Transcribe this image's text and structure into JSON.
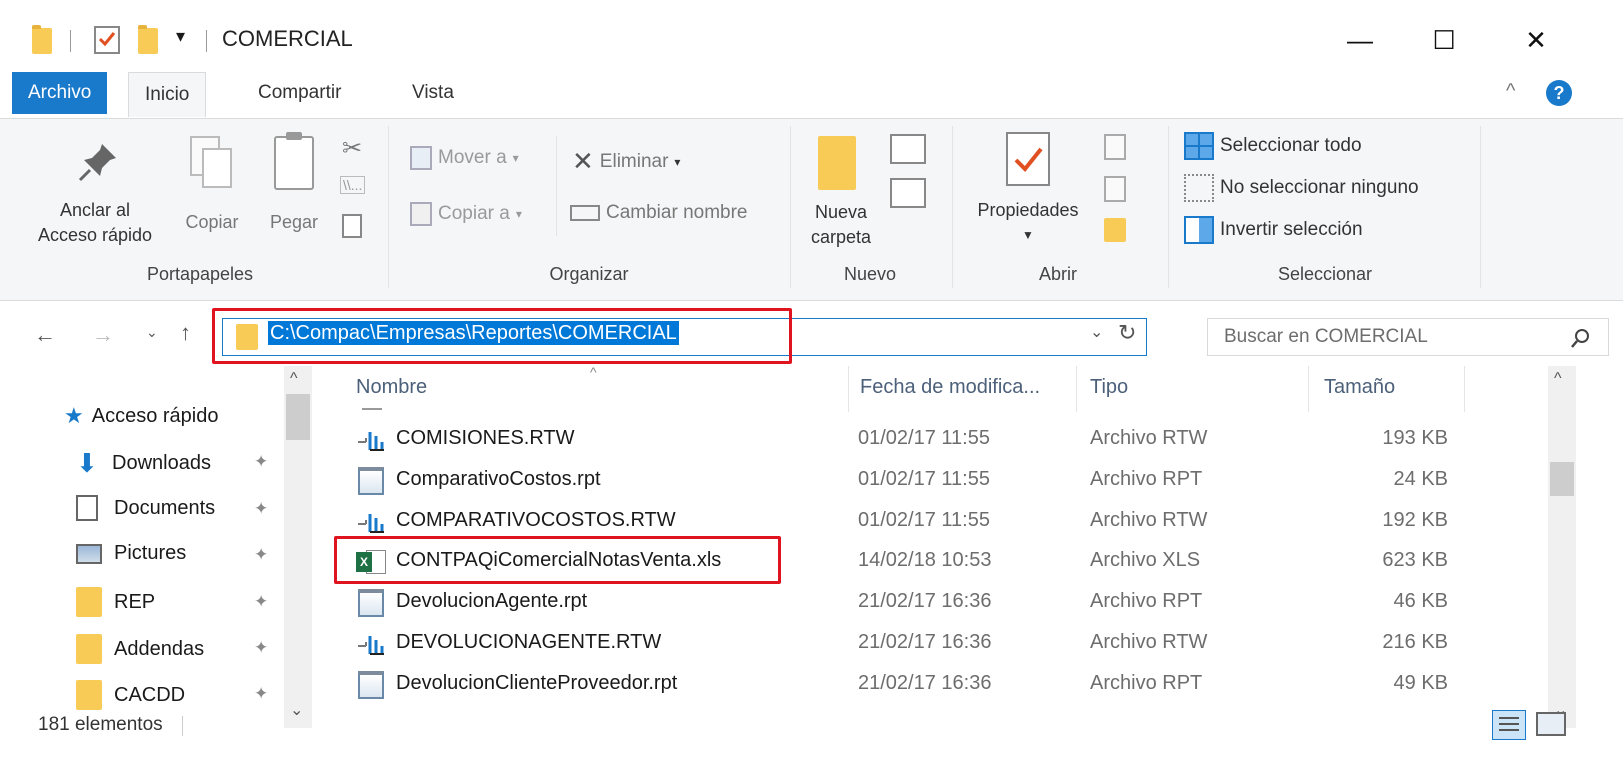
{
  "window": {
    "title": "COMERCIAL",
    "qat_dropdown": "▾",
    "minimize": "—",
    "maximize": "☐",
    "close": "✕"
  },
  "tabs": [
    {
      "label": "Archivo"
    },
    {
      "label": "Inicio"
    },
    {
      "label": "Compartir"
    },
    {
      "label": "Vista"
    }
  ],
  "ribbon": {
    "collapse_icon": "^",
    "help_icon": "?",
    "portapapeles": {
      "label": "Portapapeles",
      "pin_label_1": "Anclar al",
      "pin_label_2": "Acceso rápido",
      "copy_label": "Copiar",
      "paste_label": "Pegar"
    },
    "organizar": {
      "label": "Organizar",
      "move_to": "Mover a",
      "copy_to": "Copiar a",
      "delete": "Eliminar",
      "rename": "Cambiar nombre"
    },
    "nuevo": {
      "label": "Nuevo",
      "new_folder_1": "Nueva",
      "new_folder_2": "carpeta"
    },
    "abrir": {
      "label": "Abrir",
      "properties": "Propiedades"
    },
    "seleccionar": {
      "label": "Seleccionar",
      "select_all": "Seleccionar todo",
      "select_none": "No seleccionar ninguno",
      "invert": "Invertir selección"
    }
  },
  "address": {
    "path": "C:\\Compac\\Empresas\\Reportes\\COMERCIAL",
    "search_placeholder": "Buscar en COMERCIAL"
  },
  "nav_pane": {
    "quick_access": "Acceso rápido",
    "items": [
      {
        "label": "Downloads",
        "icon": "download-arrow-icon"
      },
      {
        "label": "Documents",
        "icon": "document-icon"
      },
      {
        "label": "Pictures",
        "icon": "pictures-icon"
      },
      {
        "label": "REP",
        "icon": "folder-icon"
      },
      {
        "label": "Addendas",
        "icon": "folder-icon"
      },
      {
        "label": "CACDD",
        "icon": "folder-icon"
      }
    ]
  },
  "columns": {
    "name": "Nombre",
    "date": "Fecha de modifica...",
    "type": "Tipo",
    "size": "Tamaño"
  },
  "files": [
    {
      "name": "COMISIONES.RTW",
      "date": "01/02/17 11:55",
      "type": "Archivo RTW",
      "size": "193 KB",
      "icon": "rtw"
    },
    {
      "name": "ComparativoCostos.rpt",
      "date": "01/02/17 11:55",
      "type": "Archivo RPT",
      "size": "24 KB",
      "icon": "rpt"
    },
    {
      "name": "COMPARATIVOCOSTOS.RTW",
      "date": "01/02/17 11:55",
      "type": "Archivo RTW",
      "size": "192 KB",
      "icon": "rtw"
    },
    {
      "name": "CONTPAQiComercialNotasVenta.xls",
      "date": "14/02/18 10:53",
      "type": "Archivo XLS",
      "size": "623 KB",
      "icon": "xls"
    },
    {
      "name": "DevolucionAgente.rpt",
      "date": "21/02/17 16:36",
      "type": "Archivo RPT",
      "size": "46 KB",
      "icon": "rpt"
    },
    {
      "name": "DEVOLUCIONAGENTE.RTW",
      "date": "21/02/17 16:36",
      "type": "Archivo RTW",
      "size": "216 KB",
      "icon": "rtw"
    },
    {
      "name": "DevolucionClienteProveedor.rpt",
      "date": "21/02/17 16:36",
      "type": "Archivo RPT",
      "size": "49 KB",
      "icon": "rpt"
    }
  ],
  "status": {
    "count": "181 elementos"
  },
  "colors": {
    "accent": "#1979ca",
    "highlight_box": "#e0141e",
    "folder": "#f8cb56"
  }
}
